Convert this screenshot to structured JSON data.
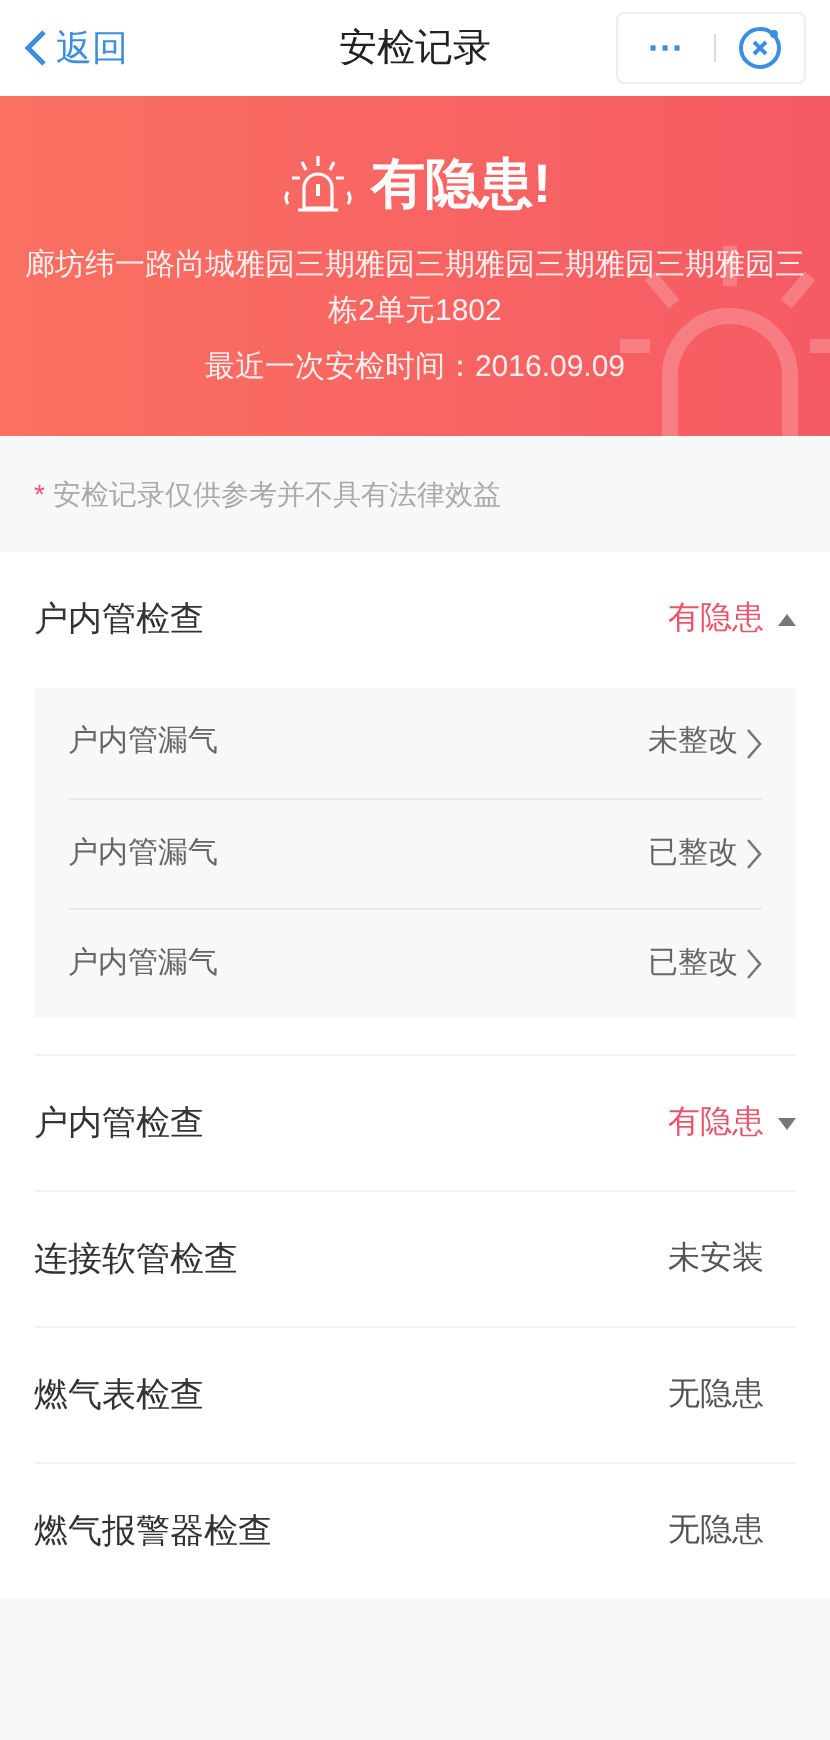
{
  "nav": {
    "back": "返回",
    "title": "安检记录",
    "more": "···"
  },
  "banner": {
    "heading": "有隐患!",
    "address": "廊坊纬一路尚城雅园三期雅园三期雅园三期雅园三期雅园三栋2单元1802",
    "last_check": "最近一次安检时间：2016.09.09"
  },
  "note": {
    "mark": "*",
    "text": "安检记录仅供参考并不具有法律效益"
  },
  "checks": [
    {
      "kind": "group",
      "name": "户内管检查",
      "status": "有隐患",
      "alert": true,
      "expanded": true,
      "items": [
        {
          "name": "户内管漏气",
          "status": "未整改"
        },
        {
          "name": "户内管漏气",
          "status": "已整改"
        },
        {
          "name": "户内管漏气",
          "status": "已整改"
        }
      ]
    },
    {
      "kind": "group",
      "name": "户内管检查",
      "status": "有隐患",
      "alert": true,
      "expanded": false
    },
    {
      "kind": "plain",
      "name": "连接软管检查",
      "status": "未安装",
      "alert": false
    },
    {
      "kind": "plain",
      "name": "燃气表检查",
      "status": "无隐患",
      "alert": false
    },
    {
      "kind": "plain",
      "name": "燃气报警器检查",
      "status": "无隐患",
      "alert": false
    }
  ]
}
